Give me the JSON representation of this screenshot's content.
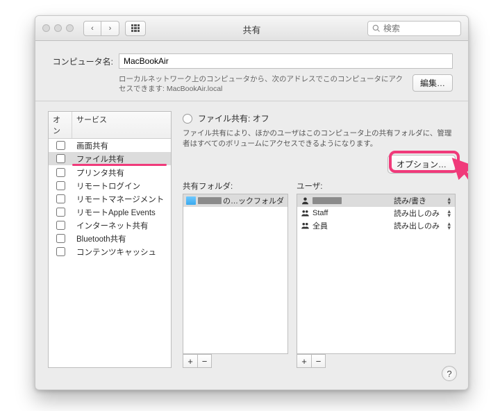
{
  "titlebar": {
    "title": "共有",
    "search_placeholder": "検索"
  },
  "computer_name": {
    "label": "コンピュータ名:",
    "value": "MacBookAir",
    "hint": "ローカルネットワーク上のコンピュータから、次のアドレスでこのコンピュータにアクセスできます: MacBookAir.local",
    "edit_button": "編集…"
  },
  "services": {
    "header_on": "オン",
    "header_service": "サービス",
    "items": [
      {
        "label": "画面共有",
        "selected": false
      },
      {
        "label": "ファイル共有",
        "selected": true
      },
      {
        "label": "プリンタ共有",
        "selected": false
      },
      {
        "label": "リモートログイン",
        "selected": false
      },
      {
        "label": "リモートマネージメント",
        "selected": false
      },
      {
        "label": "リモートApple Events",
        "selected": false
      },
      {
        "label": "インターネット共有",
        "selected": false
      },
      {
        "label": "Bluetooth共有",
        "selected": false
      },
      {
        "label": "コンテンツキャッシュ",
        "selected": false
      }
    ]
  },
  "status": {
    "title": "ファイル共有: オフ",
    "description": "ファイル共有により、ほかのユーザはこのコンピュータ上の共有フォルダに、管理者はすべてのボリュームにアクセスできるようになります。",
    "option_button": "オプション…"
  },
  "shared_folders": {
    "label": "共有フォルダ:",
    "items": [
      {
        "display": "の…ックフォルダ"
      }
    ]
  },
  "users": {
    "label": "ユーザ:",
    "items": [
      {
        "name": "",
        "masked": true,
        "perm": "読み/書き",
        "icon": "single"
      },
      {
        "name": "Staff",
        "masked": false,
        "perm": "読み出しのみ",
        "icon": "group"
      },
      {
        "name": "全員",
        "masked": false,
        "perm": "読み出しのみ",
        "icon": "group"
      }
    ]
  },
  "buttons": {
    "plus": "+",
    "minus": "−",
    "help": "?"
  }
}
